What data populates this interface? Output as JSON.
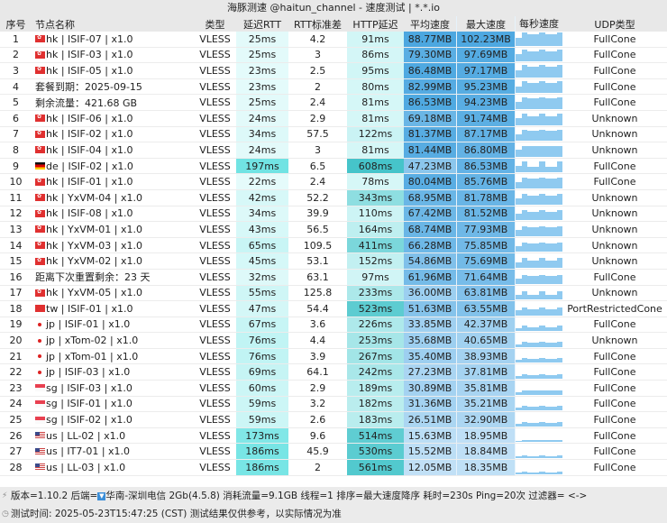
{
  "title": "海豚测速 @haitun_channel - 速度测试 | *.*.io",
  "headers": [
    "序号",
    "节点名称",
    "类型",
    "延迟RTT",
    "RTT标准差",
    "HTTP延迟",
    "平均速度",
    "最大速度",
    "每秒速度",
    "UDP类型"
  ],
  "rows": [
    {
      "n": "1",
      "flag": "hk",
      "name": "hk | ISIF-07 | x1.0",
      "type": "VLESS",
      "rtt": "25ms",
      "std": "4.2",
      "http": "91ms",
      "avg": "88.77MB",
      "max": "102.23MB",
      "udp": "FullCone"
    },
    {
      "n": "2",
      "flag": "hk",
      "name": "hk | ISIF-03 | x1.0",
      "type": "VLESS",
      "rtt": "25ms",
      "std": "3",
      "http": "86ms",
      "avg": "79.30MB",
      "max": "97.69MB",
      "udp": "FullCone"
    },
    {
      "n": "3",
      "flag": "hk",
      "name": "hk | ISIF-05 | x1.0",
      "type": "VLESS",
      "rtt": "23ms",
      "std": "2.5",
      "http": "95ms",
      "avg": "86.48MB",
      "max": "97.17MB",
      "udp": "FullCone"
    },
    {
      "n": "4",
      "flag": "",
      "name": "套餐到期：2025-09-15",
      "type": "VLESS",
      "rtt": "23ms",
      "std": "2",
      "http": "80ms",
      "avg": "82.99MB",
      "max": "95.23MB",
      "udp": "FullCone"
    },
    {
      "n": "5",
      "flag": "",
      "name": "剩余流量：421.68 GB",
      "type": "VLESS",
      "rtt": "25ms",
      "std": "2.4",
      "http": "81ms",
      "avg": "86.53MB",
      "max": "94.23MB",
      "udp": "FullCone"
    },
    {
      "n": "6",
      "flag": "hk",
      "name": "hk | ISIF-06 | x1.0",
      "type": "VLESS",
      "rtt": "24ms",
      "std": "2.9",
      "http": "81ms",
      "avg": "69.18MB",
      "max": "91.74MB",
      "udp": "Unknown"
    },
    {
      "n": "7",
      "flag": "hk",
      "name": "hk | ISIF-02 | x1.0",
      "type": "VLESS",
      "rtt": "34ms",
      "std": "57.5",
      "http": "122ms",
      "avg": "81.37MB",
      "max": "87.17MB",
      "udp": "Unknown"
    },
    {
      "n": "8",
      "flag": "hk",
      "name": "hk | ISIF-04 | x1.0",
      "type": "VLESS",
      "rtt": "24ms",
      "std": "3",
      "http": "81ms",
      "avg": "81.44MB",
      "max": "86.80MB",
      "udp": "Unknown"
    },
    {
      "n": "9",
      "flag": "de",
      "name": "de | ISIF-02 | x1.0",
      "type": "VLESS",
      "rtt": "197ms",
      "std": "6.5",
      "http": "608ms",
      "avg": "47.23MB",
      "max": "86.53MB",
      "udp": "FullCone"
    },
    {
      "n": "10",
      "flag": "hk",
      "name": "hk | ISIF-01 | x1.0",
      "type": "VLESS",
      "rtt": "22ms",
      "std": "2.4",
      "http": "78ms",
      "avg": "80.04MB",
      "max": "85.76MB",
      "udp": "FullCone"
    },
    {
      "n": "11",
      "flag": "hk",
      "name": "hk | YxVM-04 | x1.0",
      "type": "VLESS",
      "rtt": "42ms",
      "std": "52.2",
      "http": "343ms",
      "avg": "68.95MB",
      "max": "81.78MB",
      "udp": "Unknown"
    },
    {
      "n": "12",
      "flag": "hk",
      "name": "hk | ISIF-08 | x1.0",
      "type": "VLESS",
      "rtt": "34ms",
      "std": "39.9",
      "http": "110ms",
      "avg": "67.42MB",
      "max": "81.52MB",
      "udp": "Unknown"
    },
    {
      "n": "13",
      "flag": "hk",
      "name": "hk | YxVM-01 | x1.0",
      "type": "VLESS",
      "rtt": "43ms",
      "std": "56.5",
      "http": "164ms",
      "avg": "68.74MB",
      "max": "77.93MB",
      "udp": "Unknown"
    },
    {
      "n": "14",
      "flag": "hk",
      "name": "hk | YxVM-03 | x1.0",
      "type": "VLESS",
      "rtt": "65ms",
      "std": "109.5",
      "http": "411ms",
      "avg": "66.28MB",
      "max": "75.85MB",
      "udp": "Unknown"
    },
    {
      "n": "15",
      "flag": "hk",
      "name": "hk | YxVM-02 | x1.0",
      "type": "VLESS",
      "rtt": "45ms",
      "std": "53.1",
      "http": "152ms",
      "avg": "54.86MB",
      "max": "75.69MB",
      "udp": "Unknown"
    },
    {
      "n": "16",
      "flag": "",
      "name": "距离下次重置剩余：23 天",
      "type": "VLESS",
      "rtt": "32ms",
      "std": "63.1",
      "http": "97ms",
      "avg": "61.96MB",
      "max": "71.64MB",
      "udp": "FullCone"
    },
    {
      "n": "17",
      "flag": "hk",
      "name": "hk | YxVM-05 | x1.0",
      "type": "VLESS",
      "rtt": "55ms",
      "std": "125.8",
      "http": "233ms",
      "avg": "36.00MB",
      "max": "63.81MB",
      "udp": "Unknown"
    },
    {
      "n": "18",
      "flag": "tw",
      "name": "tw | ISIF-01 | x1.0",
      "type": "VLESS",
      "rtt": "47ms",
      "std": "54.4",
      "http": "523ms",
      "avg": "51.63MB",
      "max": "63.55MB",
      "udp": "PortRestrictedCone"
    },
    {
      "n": "19",
      "flag": "jp",
      "name": "jp | ISIF-01 | x1.0",
      "type": "VLESS",
      "rtt": "67ms",
      "std": "3.6",
      "http": "226ms",
      "avg": "33.85MB",
      "max": "42.37MB",
      "udp": "FullCone"
    },
    {
      "n": "20",
      "flag": "jp",
      "name": "jp | xTom-02 | x1.0",
      "type": "VLESS",
      "rtt": "76ms",
      "std": "4.4",
      "http": "253ms",
      "avg": "35.68MB",
      "max": "40.65MB",
      "udp": "Unknown"
    },
    {
      "n": "21",
      "flag": "jp",
      "name": "jp | xTom-01 | x1.0",
      "type": "VLESS",
      "rtt": "76ms",
      "std": "3.9",
      "http": "267ms",
      "avg": "35.40MB",
      "max": "38.93MB",
      "udp": "FullCone"
    },
    {
      "n": "22",
      "flag": "jp",
      "name": "jp | ISIF-03 | x1.0",
      "type": "VLESS",
      "rtt": "69ms",
      "std": "64.1",
      "http": "242ms",
      "avg": "27.23MB",
      "max": "37.81MB",
      "udp": "FullCone"
    },
    {
      "n": "23",
      "flag": "sg",
      "name": "sg | ISIF-03 | x1.0",
      "type": "VLESS",
      "rtt": "60ms",
      "std": "2.9",
      "http": "189ms",
      "avg": "30.89MB",
      "max": "35.81MB",
      "udp": "FullCone"
    },
    {
      "n": "24",
      "flag": "sg",
      "name": "sg | ISIF-01 | x1.0",
      "type": "VLESS",
      "rtt": "59ms",
      "std": "3.2",
      "http": "182ms",
      "avg": "31.36MB",
      "max": "35.21MB",
      "udp": "FullCone"
    },
    {
      "n": "25",
      "flag": "sg",
      "name": "sg | ISIF-02 | x1.0",
      "type": "VLESS",
      "rtt": "59ms",
      "std": "2.6",
      "http": "183ms",
      "avg": "26.51MB",
      "max": "32.90MB",
      "udp": "FullCone"
    },
    {
      "n": "26",
      "flag": "us",
      "name": "us | LL-02 | x1.0",
      "type": "VLESS",
      "rtt": "173ms",
      "std": "9.6",
      "http": "514ms",
      "avg": "15.63MB",
      "max": "18.95MB",
      "udp": "FullCone"
    },
    {
      "n": "27",
      "flag": "us",
      "name": "us | IT7-01 | x1.0",
      "type": "VLESS",
      "rtt": "186ms",
      "std": "45.9",
      "http": "530ms",
      "avg": "15.52MB",
      "max": "18.84MB",
      "udp": "FullCone"
    },
    {
      "n": "28",
      "flag": "us",
      "name": "us | LL-03 | x1.0",
      "type": "VLESS",
      "rtt": "186ms",
      "std": "2",
      "http": "561ms",
      "avg": "12.05MB",
      "max": "18.35MB",
      "udp": "FullCone"
    }
  ],
  "footer": {
    "line1_a": "版本=1.10.2  后端=",
    "line1_b": "华南-深圳电信 2Gb(4.5.8) 消耗流量=9.1GB  线程=1  排序=最大速度降序  耗时=230s  Ping=20次  过滤器= <->",
    "line2": "测试时间: 2025-05-23T15:47:25 (CST)  测试结果仅供参考，以实际情况为准"
  }
}
